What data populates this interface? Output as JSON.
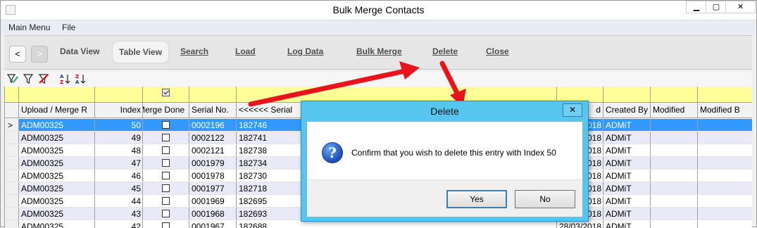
{
  "window": {
    "title": "Bulk Merge Contacts",
    "min_glyph": "▁",
    "max_glyph": "▢",
    "close_glyph": "✕"
  },
  "menu": {
    "items": [
      "Main Menu",
      "File"
    ]
  },
  "toolbar": {
    "back": "<",
    "forward": ">",
    "items": [
      "Data View",
      "Table View",
      "Search",
      "Load",
      "Log Data",
      "Bulk Merge",
      "Delete",
      "Close"
    ]
  },
  "filter_icons": [
    "filter-edit-icon",
    "filter-icon",
    "filter-clear-icon",
    "sort-ascending-icon",
    "sort-descending-icon"
  ],
  "table": {
    "columns": [
      "Upload / Merge R",
      "Index",
      "Merge Done",
      "Serial No.",
      "<<<<<<  Serial",
      "",
      "d",
      "Created By",
      "Modified",
      "Modified B"
    ],
    "rows": [
      {
        "upload": "ADM00325",
        "index": "50",
        "serial": "0002196",
        "serial2": "182746",
        "date": "018",
        "created_by": "ADMiT"
      },
      {
        "upload": "ADM00325",
        "index": "49",
        "serial": "0002122",
        "serial2": "182741",
        "date": "018",
        "created_by": "ADMiT"
      },
      {
        "upload": "ADM00325",
        "index": "48",
        "serial": "0002121",
        "serial2": "182738",
        "date": "018",
        "created_by": "ADMiT"
      },
      {
        "upload": "ADM00325",
        "index": "47",
        "serial": "0001979",
        "serial2": "182734",
        "date": "018",
        "created_by": "ADMiT"
      },
      {
        "upload": "ADM00325",
        "index": "46",
        "serial": "0001978",
        "serial2": "182730",
        "date": "018",
        "created_by": "ADMiT"
      },
      {
        "upload": "ADM00325",
        "index": "45",
        "serial": "0001977",
        "serial2": "182718",
        "date": "018",
        "created_by": "ADMiT"
      },
      {
        "upload": "ADM00325",
        "index": "44",
        "serial": "0001969",
        "serial2": "182695",
        "date": "018",
        "created_by": "ADMiT"
      },
      {
        "upload": "ADM00325",
        "index": "43",
        "serial": "0001968",
        "serial2": "182693",
        "date": "018",
        "created_by": "ADMiT"
      },
      {
        "upload": "ADM00325",
        "index": "42",
        "serial": "0001967",
        "serial2": "182688",
        "date": "28/03/2018",
        "created_by": "ADMiT"
      }
    ],
    "selected_marker": ">"
  },
  "dialog": {
    "title": "Delete",
    "close": "✕",
    "message": "Confirm that you wish to delete this entry with Index 50",
    "yes": "Yes",
    "no": "No",
    "icon_glyph": "?"
  },
  "colors": {
    "selection": "#3399ff",
    "filter_row": "#ffff99",
    "dialog_frame": "#57c6ee",
    "annotation_arrow": "#e8141b"
  }
}
